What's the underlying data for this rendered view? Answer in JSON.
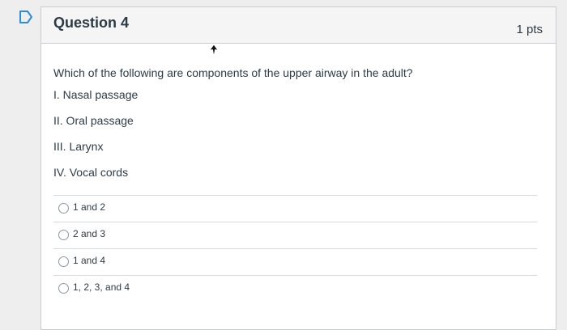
{
  "question": {
    "title": "Question 4",
    "points": "1 pts",
    "text": "Which of the following are components of the upper airway in the adult?",
    "statements": [
      "I. Nasal passage",
      "II. Oral passage",
      "III. Larynx",
      "IV. Vocal cords"
    ],
    "answers": [
      "1 and 2",
      "2 and 3",
      "1 and 4",
      "1, 2, 3, and 4"
    ]
  },
  "icons": {
    "flag": "bookmark-flag-icon",
    "cursor": "mouse-pointer-icon",
    "radio": "radio-button-icon"
  },
  "colors": {
    "flag_outline": "#2d8cd6",
    "text": "#2d3b45",
    "header_bg": "#f5f5f5",
    "border": "#c7cdd1"
  }
}
